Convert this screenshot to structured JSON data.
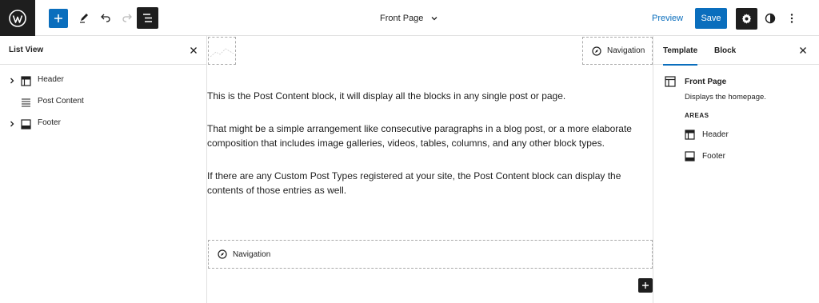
{
  "topbar": {
    "document_title": "Front Page",
    "preview_label": "Preview",
    "save_label": "Save"
  },
  "list_view": {
    "title": "List View",
    "items": [
      {
        "label": "Header",
        "icon": "header-template-part-icon",
        "expandable": true
      },
      {
        "label": "Post Content",
        "icon": "post-content-icon",
        "expandable": false
      },
      {
        "label": "Footer",
        "icon": "footer-template-part-icon",
        "expandable": true
      }
    ]
  },
  "canvas": {
    "navigation_top_label": "Navigation",
    "paragraphs": [
      "This is the Post Content block, it will display all the blocks in any single post or page.",
      "That might be a simple arrangement like consecutive paragraphs in a blog post, or a more elaborate composition that includes image galleries, videos, tables, columns, and any other block types.",
      "If there are any Custom Post Types registered at your site, the Post Content block can display the contents of those entries as well."
    ],
    "navigation_bottom_label": "Navigation"
  },
  "sidebar": {
    "tabs": [
      {
        "label": "Template",
        "active": true
      },
      {
        "label": "Block",
        "active": false
      }
    ],
    "template": {
      "title": "Front Page",
      "description": "Displays the homepage."
    },
    "areas_heading": "AREAS",
    "areas": [
      {
        "label": "Header",
        "icon": "header-template-part-icon"
      },
      {
        "label": "Footer",
        "icon": "footer-template-part-icon"
      }
    ]
  },
  "colors": {
    "accent": "#0a6ebd",
    "dark": "#1e1e1e",
    "border": "#e0e0e0"
  }
}
